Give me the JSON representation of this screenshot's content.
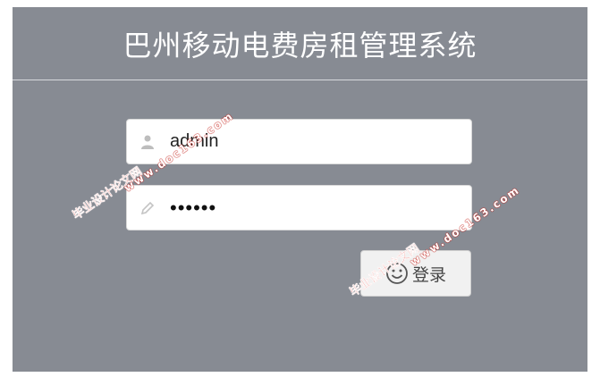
{
  "header": {
    "title": "巴州移动电费房租管理系统"
  },
  "login_form": {
    "username": {
      "value": "admin",
      "icon": "user-icon"
    },
    "password": {
      "value": "••••••",
      "icon": "pencil-icon"
    },
    "login_button": {
      "label": "登录",
      "icon": "smile-icon"
    }
  },
  "watermarks": [
    {
      "text": "毕业设计论文网",
      "url": "www.doc163.com"
    },
    {
      "text": "毕业设计论文网",
      "url": "www.doc163.com"
    }
  ],
  "colors": {
    "background": "#878b93",
    "watermark_red": "#d9251c"
  }
}
